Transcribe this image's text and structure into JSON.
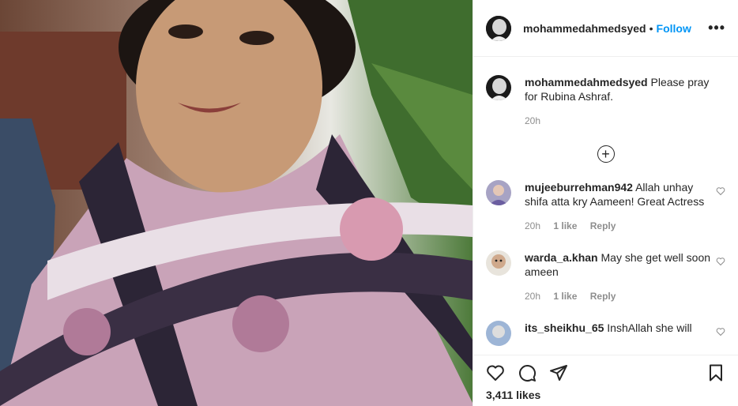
{
  "header": {
    "username": "mohammedahmedsyed",
    "separator": "•",
    "follow_label": "Follow",
    "more_label": "•••"
  },
  "caption": {
    "username": "mohammedahmedsyed",
    "text": "Please pray for Rubina Ashraf.",
    "time": "20h"
  },
  "load_more_label": "+",
  "comments": [
    {
      "username": "mujeeburrehman942",
      "text": "Allah unhay shifa atta kry Aameen! Great Actress",
      "time": "20h",
      "likes": "1 like",
      "reply": "Reply"
    },
    {
      "username": "warda_a.khan",
      "text": "May she get well soon ameen",
      "time": "20h",
      "likes": "1 like",
      "reply": "Reply"
    },
    {
      "username": "its_sheikhu_65",
      "text": "InshAllah she will",
      "time": "",
      "likes": "",
      "reply": ""
    }
  ],
  "footer": {
    "likes_count": "3,411 likes"
  },
  "icons": [
    "heart-icon",
    "comment-icon",
    "share-icon",
    "bookmark-icon",
    "more-icon",
    "add-circle-icon"
  ],
  "colors": {
    "accent": "#0095f6",
    "text": "#262626",
    "muted": "#8e8e8e",
    "border": "#efefef"
  }
}
